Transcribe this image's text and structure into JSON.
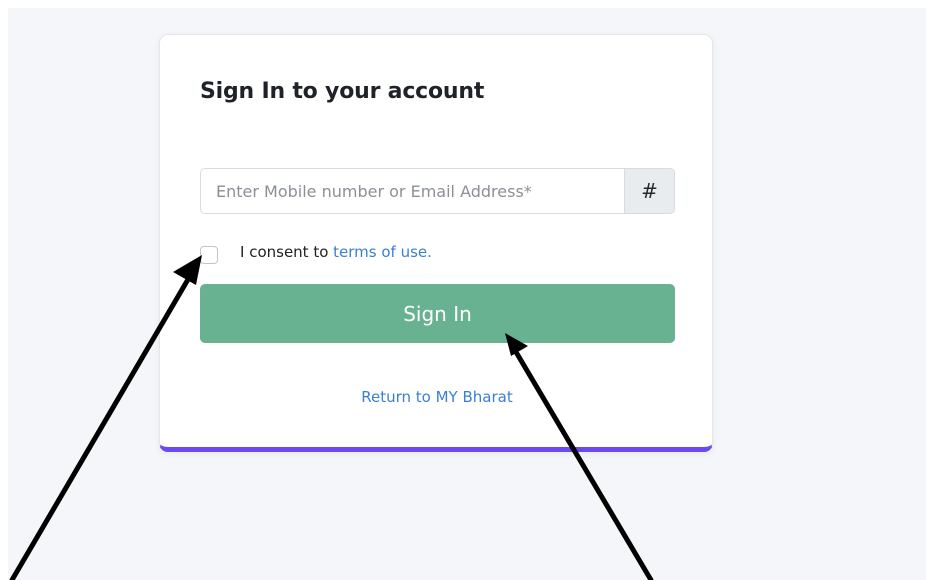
{
  "login_card": {
    "title": "Sign In to your account",
    "input_placeholder": "Enter Mobile number or Email Address*",
    "input_value": "",
    "addon_symbol": "#",
    "consent_text": "I consent to",
    "terms_link_text": "terms of use.",
    "sign_in_label": "Sign In",
    "return_link_text": "Return to MY Bharat"
  },
  "colors": {
    "page_background": "#f4f6f9",
    "button_green": "#68b291",
    "link_blue": "#3b7fd1",
    "card_accent": "#6c48f0",
    "annotation_arrow": "#000000"
  },
  "annotations": {
    "arrow_count": 2
  }
}
